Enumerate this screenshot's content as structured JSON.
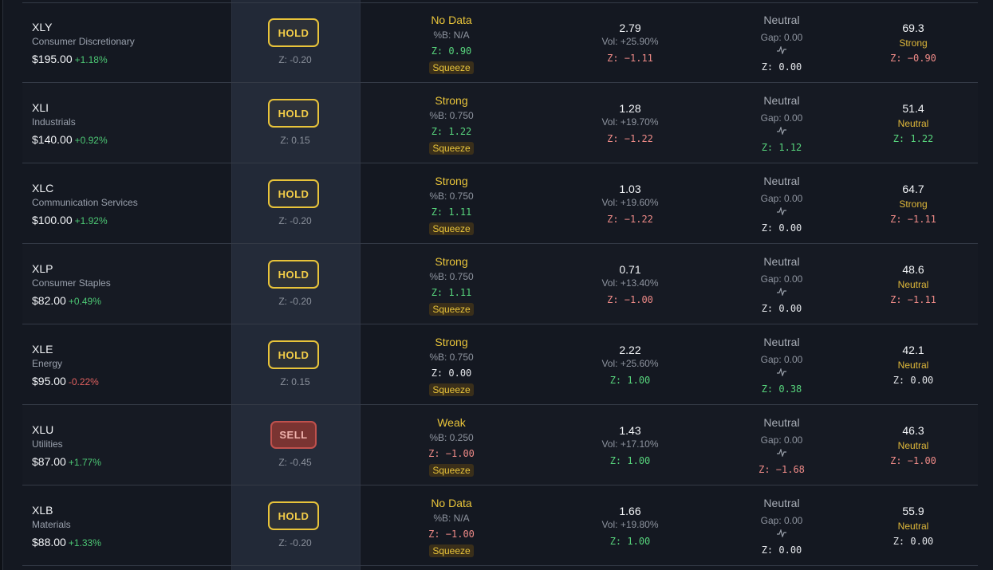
{
  "rows": [
    {
      "symbol": "XLY",
      "name": "Consumer Discretionary",
      "price": "$195.00",
      "change": "+1.18%",
      "change_dir": "pos",
      "signal": "HOLD",
      "signal_type": "hold",
      "signal_z": "Z: -0.20",
      "bb_status": "No Data",
      "bb_pct": "%B: N/A",
      "bb_z": "Z: 0.90",
      "bb_z_color": "green",
      "squeeze": "Squeeze",
      "vol_ratio": "2.79",
      "vol_change": "Vol: +25.90%",
      "vol_z": "Z: −1.11",
      "vol_z_color": "red",
      "gap_status": "Neutral",
      "gap": "Gap: 0.00",
      "gap_z": "Z: 0.00",
      "gap_z_color": "white",
      "rsi": "69.3",
      "rsi_status": "Strong",
      "rsi_z": "Z: −0.90",
      "rsi_z_color": "red"
    },
    {
      "symbol": "XLI",
      "name": "Industrials",
      "price": "$140.00",
      "change": "+0.92%",
      "change_dir": "pos",
      "signal": "HOLD",
      "signal_type": "hold",
      "signal_z": "Z: 0.15",
      "bb_status": "Strong",
      "bb_pct": "%B: 0.750",
      "bb_z": "Z: 1.22",
      "bb_z_color": "green",
      "squeeze": "Squeeze",
      "vol_ratio": "1.28",
      "vol_change": "Vol: +19.70%",
      "vol_z": "Z: −1.22",
      "vol_z_color": "red",
      "gap_status": "Neutral",
      "gap": "Gap: 0.00",
      "gap_z": "Z: 1.12",
      "gap_z_color": "green",
      "rsi": "51.4",
      "rsi_status": "Neutral",
      "rsi_z": "Z: 1.22",
      "rsi_z_color": "green"
    },
    {
      "symbol": "XLC",
      "name": "Communication Services",
      "price": "$100.00",
      "change": "+1.92%",
      "change_dir": "pos",
      "signal": "HOLD",
      "signal_type": "hold",
      "signal_z": "Z: -0.20",
      "bb_status": "Strong",
      "bb_pct": "%B: 0.750",
      "bb_z": "Z: 1.11",
      "bb_z_color": "green",
      "squeeze": "Squeeze",
      "vol_ratio": "1.03",
      "vol_change": "Vol: +19.60%",
      "vol_z": "Z: −1.22",
      "vol_z_color": "red",
      "gap_status": "Neutral",
      "gap": "Gap: 0.00",
      "gap_z": "Z: 0.00",
      "gap_z_color": "white",
      "rsi": "64.7",
      "rsi_status": "Strong",
      "rsi_z": "Z: −1.11",
      "rsi_z_color": "red"
    },
    {
      "symbol": "XLP",
      "name": "Consumer Staples",
      "price": "$82.00",
      "change": "+0.49%",
      "change_dir": "pos",
      "signal": "HOLD",
      "signal_type": "hold",
      "signal_z": "Z: -0.20",
      "bb_status": "Strong",
      "bb_pct": "%B: 0.750",
      "bb_z": "Z: 1.11",
      "bb_z_color": "green",
      "squeeze": "Squeeze",
      "vol_ratio": "0.71",
      "vol_change": "Vol: +13.40%",
      "vol_z": "Z: −1.00",
      "vol_z_color": "red",
      "gap_status": "Neutral",
      "gap": "Gap: 0.00",
      "gap_z": "Z: 0.00",
      "gap_z_color": "white",
      "rsi": "48.6",
      "rsi_status": "Neutral",
      "rsi_z": "Z: −1.11",
      "rsi_z_color": "red"
    },
    {
      "symbol": "XLE",
      "name": "Energy",
      "price": "$95.00",
      "change": "-0.22%",
      "change_dir": "neg",
      "signal": "HOLD",
      "signal_type": "hold",
      "signal_z": "Z: 0.15",
      "bb_status": "Strong",
      "bb_pct": "%B: 0.750",
      "bb_z": "Z: 0.00",
      "bb_z_color": "white",
      "squeeze": "Squeeze",
      "vol_ratio": "2.22",
      "vol_change": "Vol: +25.60%",
      "vol_z": "Z: 1.00",
      "vol_z_color": "green",
      "gap_status": "Neutral",
      "gap": "Gap: 0.00",
      "gap_z": "Z: 0.38",
      "gap_z_color": "green",
      "rsi": "42.1",
      "rsi_status": "Neutral",
      "rsi_z": "Z: 0.00",
      "rsi_z_color": "white"
    },
    {
      "symbol": "XLU",
      "name": "Utilities",
      "price": "$87.00",
      "change": "+1.77%",
      "change_dir": "pos",
      "signal": "SELL",
      "signal_type": "sell",
      "signal_z": "Z: -0.45",
      "bb_status": "Weak",
      "bb_pct": "%B: 0.250",
      "bb_z": "Z: −1.00",
      "bb_z_color": "red",
      "squeeze": "Squeeze",
      "vol_ratio": "1.43",
      "vol_change": "Vol: +17.10%",
      "vol_z": "Z: 1.00",
      "vol_z_color": "green",
      "gap_status": "Neutral",
      "gap": "Gap: 0.00",
      "gap_z": "Z: −1.68",
      "gap_z_color": "red",
      "rsi": "46.3",
      "rsi_status": "Neutral",
      "rsi_z": "Z: −1.00",
      "rsi_z_color": "red"
    },
    {
      "symbol": "XLB",
      "name": "Materials",
      "price": "$88.00",
      "change": "+1.33%",
      "change_dir": "pos",
      "signal": "HOLD",
      "signal_type": "hold",
      "signal_z": "Z: -0.20",
      "bb_status": "No Data",
      "bb_pct": "%B: N/A",
      "bb_z": "Z: −1.00",
      "bb_z_color": "red",
      "squeeze": "Squeeze",
      "vol_ratio": "1.66",
      "vol_change": "Vol: +19.80%",
      "vol_z": "Z: 1.00",
      "vol_z_color": "green",
      "gap_status": "Neutral",
      "gap": "Gap: 0.00",
      "gap_z": "Z: 0.00",
      "gap_z_color": "white",
      "rsi": "55.9",
      "rsi_status": "Neutral",
      "rsi_z": "Z: 0.00",
      "rsi_z_color": "white"
    }
  ],
  "icons": {
    "gap_trend": "pulse-icon"
  },
  "colors": {
    "hold": "#e9c43a",
    "sell": "#c0514d",
    "positive": "#4cc774",
    "negative": "#e0605f"
  }
}
